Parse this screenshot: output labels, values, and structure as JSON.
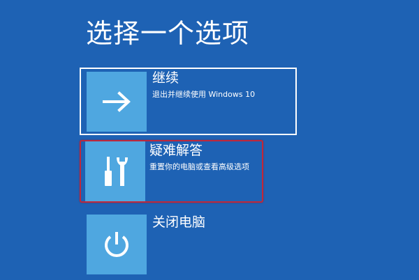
{
  "screen": {
    "title": "选择一个选项",
    "background_color": "#1e62b4",
    "tile_color": "#4fa7e0",
    "highlight_color": "#c0283a"
  },
  "options": [
    {
      "title": "继续",
      "description": "退出并继续使用 Windows 10",
      "icon": "arrow-right-icon"
    },
    {
      "title": "疑难解答",
      "description": "重置你的电脑或查看高级选项",
      "icon": "tools-icon"
    },
    {
      "title": "关闭电脑",
      "icon": "power-icon"
    }
  ]
}
